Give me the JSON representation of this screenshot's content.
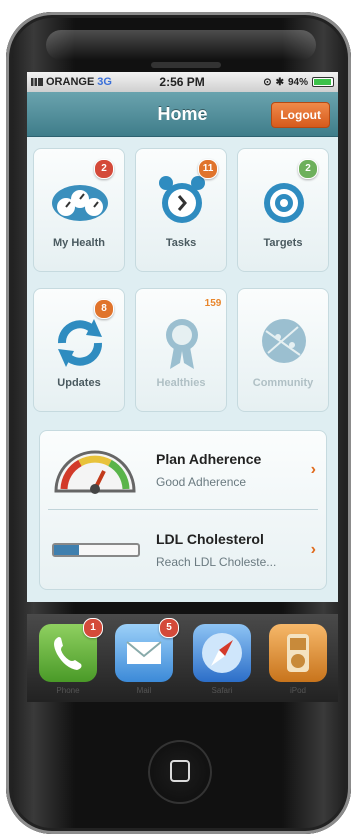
{
  "status": {
    "carrier": "ORANGE",
    "network": "3G",
    "time": "2:56 PM",
    "battery": "94%",
    "battery_level": 0.94
  },
  "nav": {
    "title": "Home",
    "logout": "Logout"
  },
  "tiles": [
    {
      "label": "My Health",
      "badge": "2",
      "icon": "dashboard-icon"
    },
    {
      "label": "Tasks",
      "badge": "11",
      "icon": "alarm-clock-icon"
    },
    {
      "label": "Targets",
      "badge": "2",
      "icon": "target-icon"
    },
    {
      "label": "Updates",
      "badge": "8",
      "icon": "refresh-icon"
    },
    {
      "label": "Healthies",
      "badge": "159",
      "icon": "ribbon-icon"
    },
    {
      "label": "Community",
      "badge": "",
      "icon": "globe-icon"
    }
  ],
  "rows": [
    {
      "title": "Plan Adherence",
      "subtitle": "Good Adherence",
      "icon": "gauge-icon"
    },
    {
      "title": "LDL Cholesterol",
      "subtitle": "Reach LDL Choleste...",
      "icon": "progress-bar-icon",
      "progress": 0.3
    }
  ],
  "dock": [
    {
      "label": "Phone",
      "badge": "1",
      "icon": "phone-icon",
      "color": "#6bb240"
    },
    {
      "label": "Mail",
      "badge": "5",
      "icon": "mail-icon",
      "color": "#5aa8e8"
    },
    {
      "label": "Safari",
      "badge": "",
      "icon": "compass-icon",
      "color": "#3f86d8"
    },
    {
      "label": "iPod",
      "badge": "",
      "icon": "ipod-icon",
      "color": "#e08a2a"
    }
  ]
}
